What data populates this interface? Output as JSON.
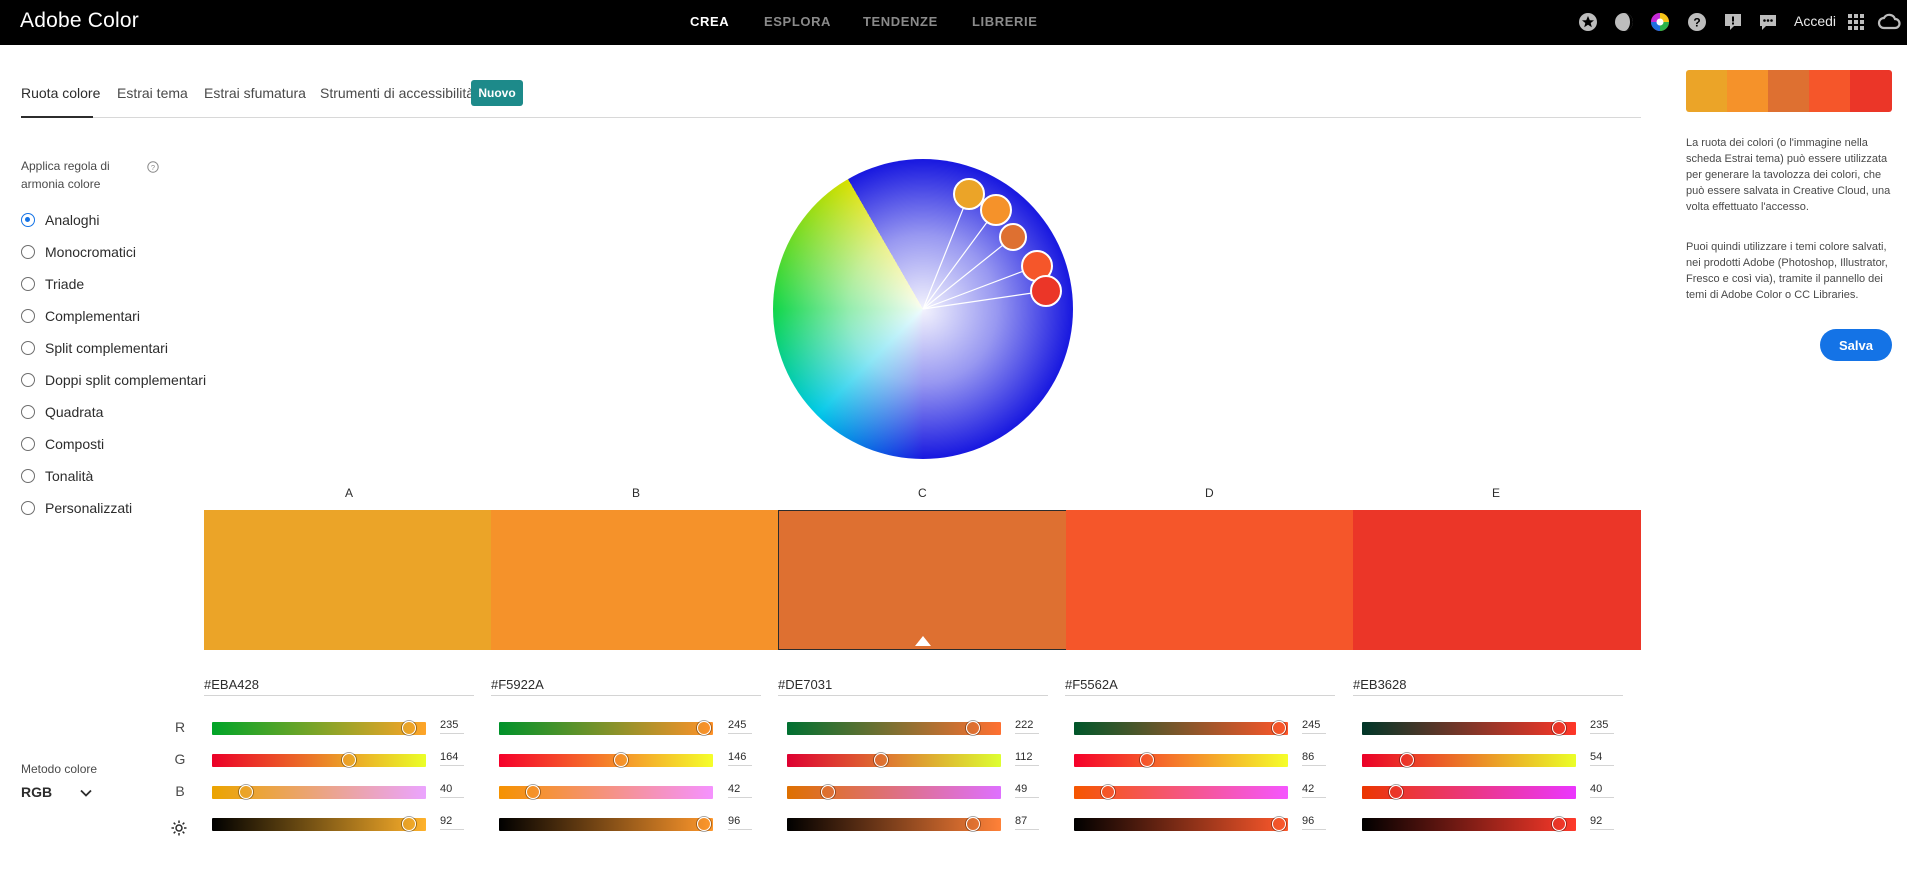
{
  "app": {
    "title": "Adobe Color"
  },
  "topnav": [
    "CREA",
    "ESPLORA",
    "TENDENZE",
    "LIBRERIE"
  ],
  "topbar": {
    "signin": "Accedi",
    "icons": [
      "star-icon",
      "moon-icon",
      "color-wheel-icon",
      "help-icon",
      "feedback-icon",
      "chat-icon",
      "apps-grid-icon",
      "creative-cloud-icon"
    ]
  },
  "tabs": {
    "items": [
      "Ruota colore",
      "Estrai tema",
      "Estrai sfumatura",
      "Strumenti di accessibilità"
    ],
    "badge": "Nuovo"
  },
  "harmony": {
    "title": "Applica regola di armonia colore",
    "selected": "Analoghi",
    "options": [
      "Analoghi",
      "Monocromatici",
      "Triade",
      "Complementari",
      "Split complementari",
      "Doppi split complementari",
      "Quadrata",
      "Composti",
      "Tonalità",
      "Personalizzati"
    ]
  },
  "colorMethod": {
    "label": "Metodo colore",
    "value": "RGB"
  },
  "channels": [
    "R",
    "G",
    "B"
  ],
  "swatches": [
    {
      "letter": "A",
      "hex": "#EBA428",
      "r": "235",
      "g": "164",
      "b": "40",
      "bright": "92"
    },
    {
      "letter": "B",
      "hex": "#F5922A",
      "r": "245",
      "g": "146",
      "b": "42",
      "bright": "96"
    },
    {
      "letter": "C",
      "hex": "#DE7031",
      "r": "222",
      "g": "112",
      "b": "49",
      "bright": "87"
    },
    {
      "letter": "D",
      "hex": "#F5562A",
      "r": "245",
      "g": "86",
      "b": "42",
      "bright": "96"
    },
    {
      "letter": "E",
      "hex": "#EB3628",
      "r": "235",
      "g": "54",
      "b": "40",
      "bright": "92"
    }
  ],
  "selectedSwatch": "C",
  "info": {
    "p1": "La ruota dei colori (o l'immagine nella scheda Estrai tema) può essere utilizzata per generare la tavolozza dei colori, che può essere salvata in Creative Cloud, una volta effettuato l'accesso.",
    "p2": "Puoi quindi utilizzare i temi colore salvati, nei prodotti Adobe (Photoshop, Illustrator, Fresco e così via), tramite il pannello dei temi di Adobe Color o CC Libraries."
  },
  "saveLabel": "Salva"
}
